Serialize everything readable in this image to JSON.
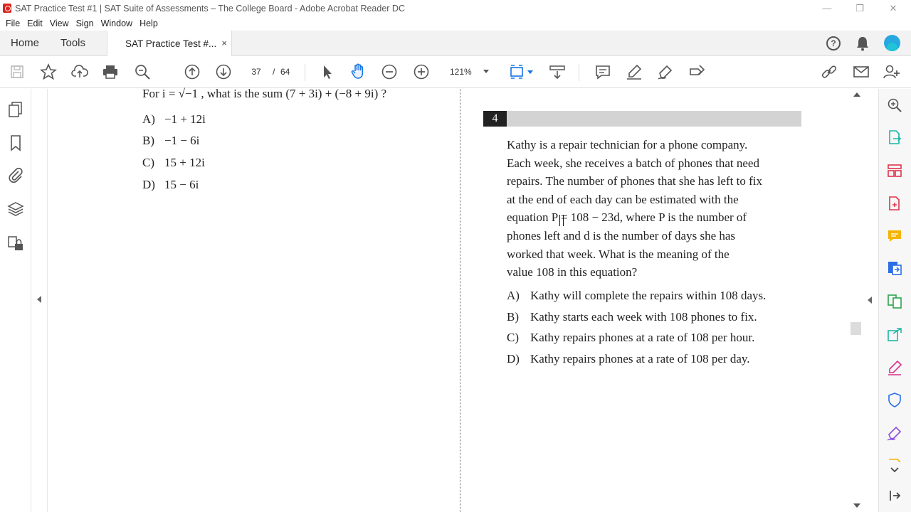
{
  "window": {
    "title": "SAT Practice Test #1 | SAT Suite of Assessments – The College Board - Adobe Acrobat Reader DC",
    "controls": {
      "minimize": "—",
      "restore": "❐",
      "close": "✕"
    }
  },
  "menu": [
    "File",
    "Edit",
    "View",
    "Sign",
    "Window",
    "Help"
  ],
  "tabs": {
    "home": "Home",
    "tools": "Tools",
    "document": "SAT Practice Test #...",
    "close": "×"
  },
  "toolbar": {
    "current_page": "37",
    "separator": "/",
    "total_pages": "64",
    "zoom": "121%"
  },
  "left_page": {
    "stem": "For  i = √−1 , what is the sum (7 + 3i)  + (−8 + 9i) ?",
    "answers": [
      {
        "letter": "A)",
        "text": "−1 + 12i"
      },
      {
        "letter": "B)",
        "text": "−1 − 6i"
      },
      {
        "letter": "C)",
        "text": "15 + 12i"
      },
      {
        "letter": "D)",
        "text": "15 − 6i"
      }
    ]
  },
  "right_page": {
    "number": "4",
    "lines": [
      "Kathy is a repair technician for a phone company.",
      "Each week, she receives a batch of phones that need",
      "repairs.  The number of phones that she has left to fix",
      "at the end of each day can be estimated with the",
      "equation  P = 108 − 23d, where  P  is the number of",
      "phones left and  d  is the number of days she has",
      "worked that week.  What is the meaning of the",
      "value 108 in this equation?"
    ],
    "choices": [
      {
        "letter": "A)",
        "text": "Kathy will complete the repairs within 108 days."
      },
      {
        "letter": "B)",
        "text": "Kathy starts each week with 108 phones to fix."
      },
      {
        "letter": "C)",
        "text": "Kathy repairs phones at a rate of 108 per hour."
      },
      {
        "letter": "D)",
        "text": "Kathy repairs phones at a rate of 108 per day."
      }
    ]
  },
  "colors": {
    "accent_blue": "#1473e6",
    "toolbar_icon": "#555555",
    "brand_red": "#d9251d"
  }
}
